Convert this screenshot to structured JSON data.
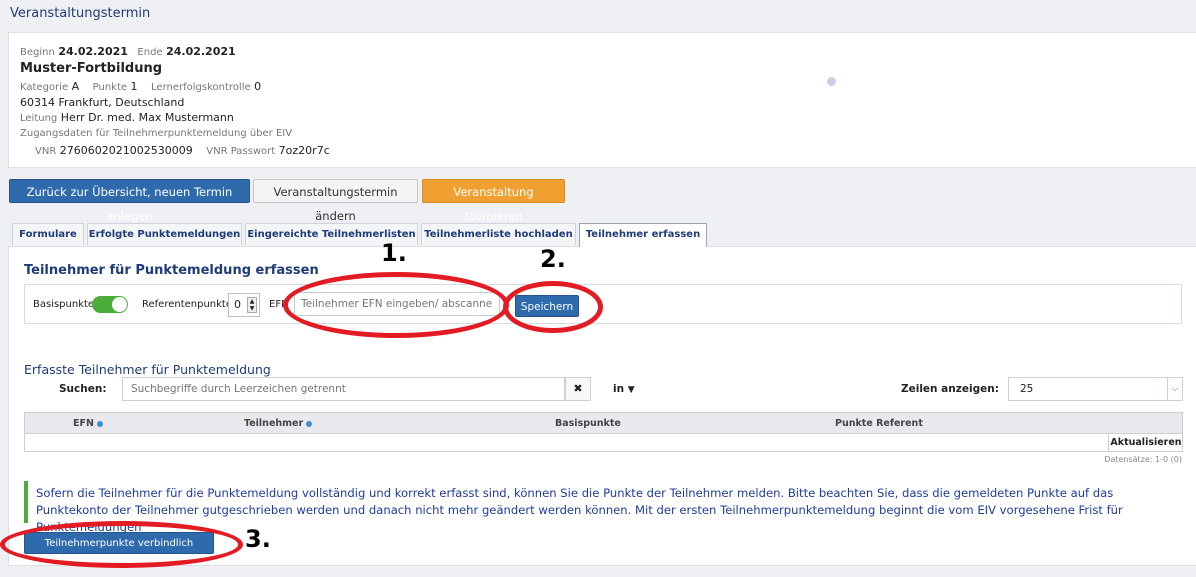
{
  "page": {
    "title": "Veranstaltungstermin"
  },
  "event": {
    "begin_label": "Beginn",
    "begin_value": "24.02.2021",
    "end_label": "Ende",
    "end_value": "24.02.2021",
    "name": "Muster-Fortbildung",
    "category_label": "Kategorie",
    "category_value": "A",
    "points_label": "Punkte",
    "points_value": "1",
    "control_label": "Lernerfolgskontrolle",
    "control_value": "0",
    "address": "60314 Frankfurt, Deutschland",
    "lead_label": "Leitung",
    "lead_value": "Herr Dr. med. Max Mustermann",
    "access_note": "Zugangsdaten für Teilnehmerpunktemeldung über EIV",
    "vnr_label": "VNR",
    "vnr_value": "2760602021002530009",
    "vnr_pw_label": "VNR Passwort",
    "vnr_pw_value": "7oz20r7c"
  },
  "actions": {
    "back": "Zurück zur Übersicht, neuen Termin anlegen",
    "edit": "Veranstaltungstermin ändern",
    "cancel": "Veranstaltung stornieren"
  },
  "tabs": [
    "Formulare",
    "Erfolgte Punktemeldungen",
    "Eingereichte Teilnehmerlisten",
    "Teilnehmerliste hochladen",
    "Teilnehmer erfassen"
  ],
  "capture": {
    "title": "Teilnehmer für Punktemeldung erfassen",
    "base_points_label": "Basispunkte",
    "ref_points_label": "Referentenpunkte",
    "ref_points_value": "0",
    "efn_label": "EFN",
    "efn_placeholder": "Teilnehmer EFN eingeben/ abscannen",
    "save": "Speichern"
  },
  "list": {
    "title": "Erfasste Teilnehmer für Punktemeldung",
    "search_label": "Suchen:",
    "search_placeholder": "Suchbegriffe durch Leerzeichen getrennt",
    "clear_icon": "✖",
    "in_label": "in",
    "rows_label": "Zeilen anzeigen:",
    "rows_value": "25",
    "columns": [
      "EFN",
      "Teilnehmer",
      "Basispunkte",
      "Punkte Referent"
    ],
    "refresh": "Aktualisieren",
    "records": "Datensätze: 1-0 (0)"
  },
  "notice": {
    "text": "Sofern die Teilnehmer für die Punktemeldung vollständig und korrekt erfasst sind, können Sie die Punkte der Teilnehmer melden. Bitte beachten Sie, dass die gemeldeten Punkte auf das Punktekonto der Teilnehmer gutgeschrieben werden und danach nicht mehr geändert werden können. Mit der ersten Teilnehmerpunktemeldung beginnt die vom EIV vorgesehene Frist für Punktemeldungen",
    "submit": "Teilnehmerpunkte verbindlich melden"
  },
  "annotations": {
    "one": "1.",
    "two": "2.",
    "three": "3."
  },
  "colors": {
    "accent": "#2f6aad",
    "warning": "#f0a030",
    "toggle": "#4cae3a",
    "highlight": "#e31b23"
  }
}
